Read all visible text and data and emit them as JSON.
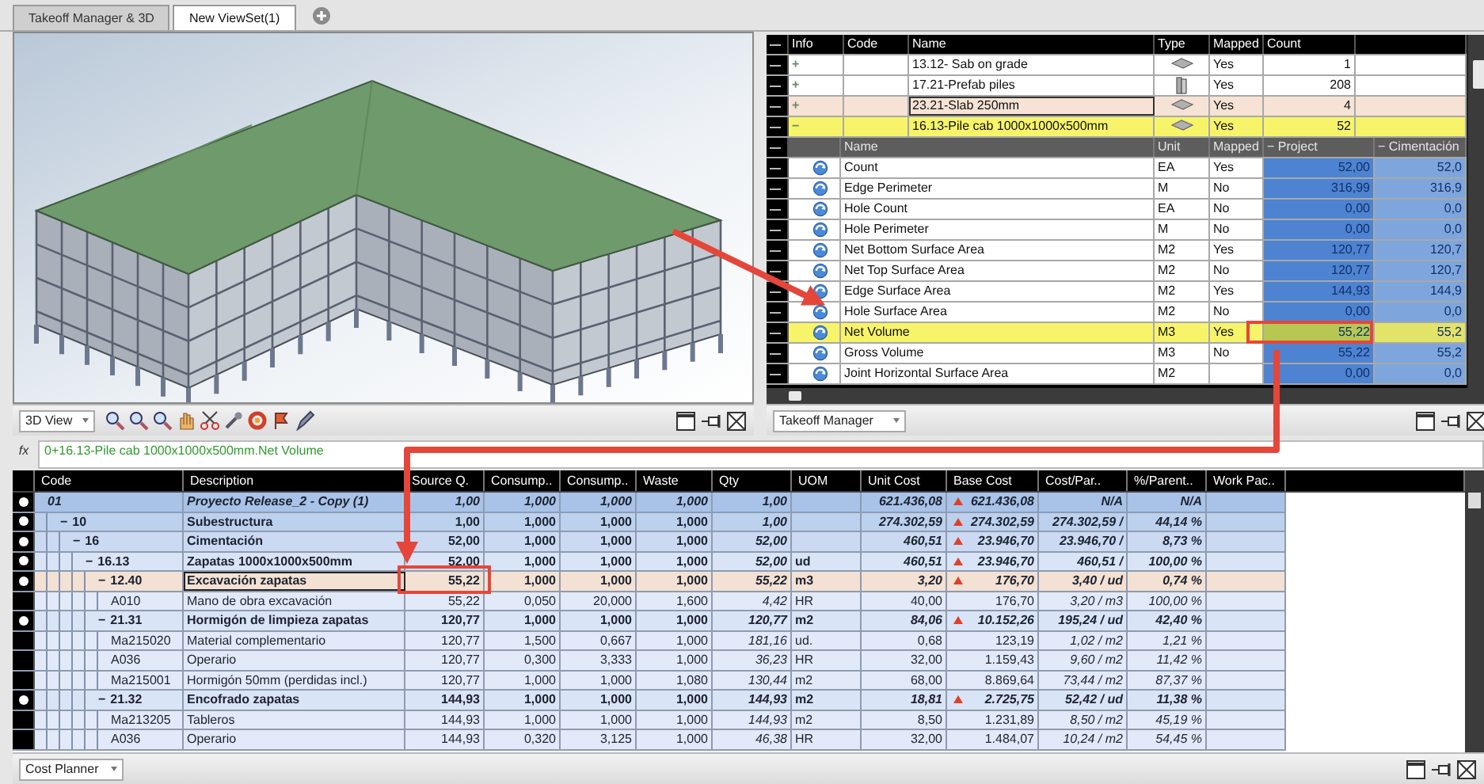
{
  "tabs": [
    {
      "label": "Takeoff Manager & 3D",
      "selected": false
    },
    {
      "label": "New ViewSet(1)",
      "selected": true
    }
  ],
  "viewer": {
    "panel_selector": "3D View"
  },
  "takeoff": {
    "columns": [
      "Info",
      "Code",
      "Name",
      "Type",
      "Mapped",
      "Count"
    ],
    "items": [
      {
        "toggle": "+",
        "name": "13.12- Sab on grade",
        "kind": "slab",
        "mapped": "Yes",
        "count": "1",
        "selected": false,
        "focused": false
      },
      {
        "toggle": "+",
        "name": "17.21-Prefab piles",
        "kind": "pile",
        "mapped": "Yes",
        "count": "208",
        "selected": false,
        "focused": false
      },
      {
        "toggle": "+",
        "name": "23.21-Slab 250mm",
        "kind": "slab",
        "mapped": "Yes",
        "count": "4",
        "selected": false,
        "focused": true
      },
      {
        "toggle": "−",
        "name": "16.13-Pile cab 1000x1000x500mm",
        "kind": "slab",
        "mapped": "Yes",
        "count": "52",
        "selected": true,
        "focused": false,
        "details": {
          "columns": [
            "Name",
            "Unit",
            "Mapped",
            "− Project",
            "− Cimentación"
          ],
          "rows": [
            {
              "name": "Count",
              "unit": "EA",
              "mapped": "Yes",
              "project": "52,00",
              "cimentacion": "52,0",
              "selected": false
            },
            {
              "name": "Edge Perimeter",
              "unit": "M",
              "mapped": "No",
              "project": "316,99",
              "cimentacion": "316,9",
              "selected": false
            },
            {
              "name": "Hole Count",
              "unit": "EA",
              "mapped": "No",
              "project": "0,00",
              "cimentacion": "0,0",
              "selected": false
            },
            {
              "name": "Hole Perimeter",
              "unit": "M",
              "mapped": "No",
              "project": "0,00",
              "cimentacion": "0,0",
              "selected": false
            },
            {
              "name": "Net Bottom Surface Area",
              "unit": "M2",
              "mapped": "Yes",
              "project": "120,77",
              "cimentacion": "120,7",
              "selected": false
            },
            {
              "name": "Net Top Surface Area",
              "unit": "M2",
              "mapped": "No",
              "project": "120,77",
              "cimentacion": "120,7",
              "selected": false
            },
            {
              "name": "Edge Surface Area",
              "unit": "M2",
              "mapped": "Yes",
              "project": "144,93",
              "cimentacion": "144,9",
              "selected": false
            },
            {
              "name": "Hole Surface Area",
              "unit": "M2",
              "mapped": "No",
              "project": "0,00",
              "cimentacion": "0,0",
              "selected": false
            },
            {
              "name": "Net Volume",
              "unit": "M3",
              "mapped": "Yes",
              "project": "55,22",
              "cimentacion": "55,2",
              "selected": true
            },
            {
              "name": "Gross Volume",
              "unit": "M3",
              "mapped": "No",
              "project": "55,22",
              "cimentacion": "55,2",
              "selected": false
            },
            {
              "name": "Joint Horizontal Surface Area",
              "unit": "M2",
              "project": "0,00",
              "cimentacion": "0,0",
              "selected": false
            }
          ]
        }
      }
    ],
    "panel_selector": "Takeoff Manager"
  },
  "formula": {
    "label": "fx",
    "value": "0+16.13-Pile cab 1000x1000x500mm.Net Volume"
  },
  "cost_planner": {
    "columns": [
      "Code",
      "Description",
      "Source Q.",
      "Consump..",
      "Consump..",
      "Waste",
      "Qty",
      "UOM",
      "Unit Cost",
      "Base Cost",
      "Cost/Par..",
      "%/Parent..",
      "Work Pac.."
    ],
    "rows": [
      {
        "code": "01",
        "description": "Proyecto Release_2 - Copy (1)",
        "kind": "project",
        "bullet": true,
        "selected": false,
        "values": [
          "1,00",
          "1,000",
          "1,000",
          "1,000",
          "1,00"
        ],
        "costs": [
          "621.436,08",
          "621.436,08",
          "N/A",
          "N/A"
        ],
        "alert": true,
        "children": [
          {
            "toggle": "−",
            "code": "10",
            "description": "Subestructura",
            "kind": "summary",
            "bullet": true,
            "selected": false,
            "values": [
              "1,00",
              "1,000",
              "1,000",
              "1,000",
              "1,00"
            ],
            "costs": [
              "274.302,59",
              "274.302,59",
              "274.302,59 /",
              "44,14 %"
            ],
            "alert": true,
            "children": [
              {
                "toggle": "−",
                "code": "16",
                "description": "Cimentación",
                "kind": "summary",
                "bullet": true,
                "selected": false,
                "values": [
                  "52,00",
                  "1,000",
                  "1,000",
                  "1,000",
                  "52,00"
                ],
                "costs": [
                  "460,51",
                  "23.946,70",
                  "23.946,70 /",
                  "8,73 %"
                ],
                "alert": true,
                "children": [
                  {
                    "toggle": "−",
                    "code": "16.13",
                    "description": "Zapatas 1000x1000x500mm",
                    "kind": "summary",
                    "bullet": true,
                    "selected": false,
                    "values": [
                      "52,00",
                      "1,000",
                      "1,000",
                      "1,000",
                      "52,00"
                    ],
                    "uom": "ud",
                    "costs": [
                      "460,51",
                      "23.946,70",
                      "460,51 /",
                      "100,00 %"
                    ],
                    "alert": true,
                    "children": [
                      {
                        "toggle": "−",
                        "code": "12.40",
                        "description": "Excavación zapatas",
                        "kind": "summary",
                        "bullet": true,
                        "selected": true,
                        "values": [
                          "55,22",
                          "1,000",
                          "1,000",
                          "1,000",
                          "55,22"
                        ],
                        "uom": "m3",
                        "costs": [
                          "3,20",
                          "176,70",
                          "3,40 / ud",
                          "0,74 %"
                        ],
                        "alert": true,
                        "children": [
                          {
                            "code": "A010",
                            "description": "Mano de obra excavación",
                            "kind": "resource",
                            "bullet": false,
                            "selected": false,
                            "values": [
                              "55,22",
                              "0,050",
                              "20,000",
                              "1,600",
                              "4,42"
                            ],
                            "uom": "HR",
                            "costs": [
                              "40,00",
                              "176,70",
                              "3,20 / m3",
                              "100,00 %"
                            ],
                            "alert": false
                          }
                        ]
                      },
                      {
                        "toggle": "−",
                        "code": "21.31",
                        "description": "Hormigón de limpieza zapatas",
                        "kind": "summary",
                        "bullet": true,
                        "selected": false,
                        "values": [
                          "120,77",
                          "1,000",
                          "1,000",
                          "1,000",
                          "120,77"
                        ],
                        "uom": "m2",
                        "costs": [
                          "84,06",
                          "10.152,26",
                          "195,24 / ud",
                          "42,40 %"
                        ],
                        "alert": true,
                        "children": [
                          {
                            "code": "Ma215020",
                            "description": "Material complementario",
                            "kind": "resource",
                            "bullet": false,
                            "selected": false,
                            "values": [
                              "120,77",
                              "1,500",
                              "0,667",
                              "1,000",
                              "181,16"
                            ],
                            "uom": "ud.",
                            "costs": [
                              "0,68",
                              "123,19",
                              "1,02 / m2",
                              "1,21 %"
                            ],
                            "alert": false
                          },
                          {
                            "code": "A036",
                            "description": "Operario",
                            "kind": "resource",
                            "bullet": false,
                            "selected": false,
                            "values": [
                              "120,77",
                              "0,300",
                              "3,333",
                              "1,000",
                              "36,23"
                            ],
                            "uom": "HR",
                            "costs": [
                              "32,00",
                              "1.159,43",
                              "9,60 / m2",
                              "11,42 %"
                            ],
                            "alert": false
                          },
                          {
                            "code": "Ma215001",
                            "description": "Hormigón 50mm (perdidas incl.)",
                            "kind": "resource",
                            "bullet": false,
                            "selected": false,
                            "values": [
                              "120,77",
                              "1,000",
                              "1,000",
                              "1,080",
                              "130,44"
                            ],
                            "uom": "m2",
                            "costs": [
                              "68,00",
                              "8.869,64",
                              "73,44 / m2",
                              "87,37 %"
                            ],
                            "alert": false
                          }
                        ]
                      },
                      {
                        "toggle": "−",
                        "code": "21.32",
                        "description": "Encofrado zapatas",
                        "kind": "summary",
                        "bullet": true,
                        "selected": false,
                        "values": [
                          "144,93",
                          "1,000",
                          "1,000",
                          "1,000",
                          "144,93"
                        ],
                        "uom": "m2",
                        "costs": [
                          "18,81",
                          "2.725,75",
                          "52,42 / ud",
                          "11,38 %"
                        ],
                        "alert": true,
                        "children": [
                          {
                            "code": "Ma213205",
                            "description": "Tableros",
                            "kind": "resource",
                            "bullet": false,
                            "selected": false,
                            "values": [
                              "144,93",
                              "1,000",
                              "1,000",
                              "1,000",
                              "144,93"
                            ],
                            "uom": "m2",
                            "costs": [
                              "8,50",
                              "1.231,89",
                              "8,50 / m2",
                              "45,19 %"
                            ],
                            "alert": false
                          },
                          {
                            "code": "A036",
                            "description": "Operario",
                            "kind": "resource",
                            "bullet": false,
                            "selected": false,
                            "values": [
                              "144,93",
                              "0,320",
                              "3,125",
                              "1,000",
                              "46,38"
                            ],
                            "uom": "HR",
                            "costs": [
                              "32,00",
                              "1.484,07",
                              "10,24 / m2",
                              "54,45 %"
                            ],
                            "alert": false
                          }
                        ]
                      }
                    ]
                  }
                ]
              }
            ]
          }
        ]
      }
    ],
    "panel_selector": "Cost Planner"
  }
}
